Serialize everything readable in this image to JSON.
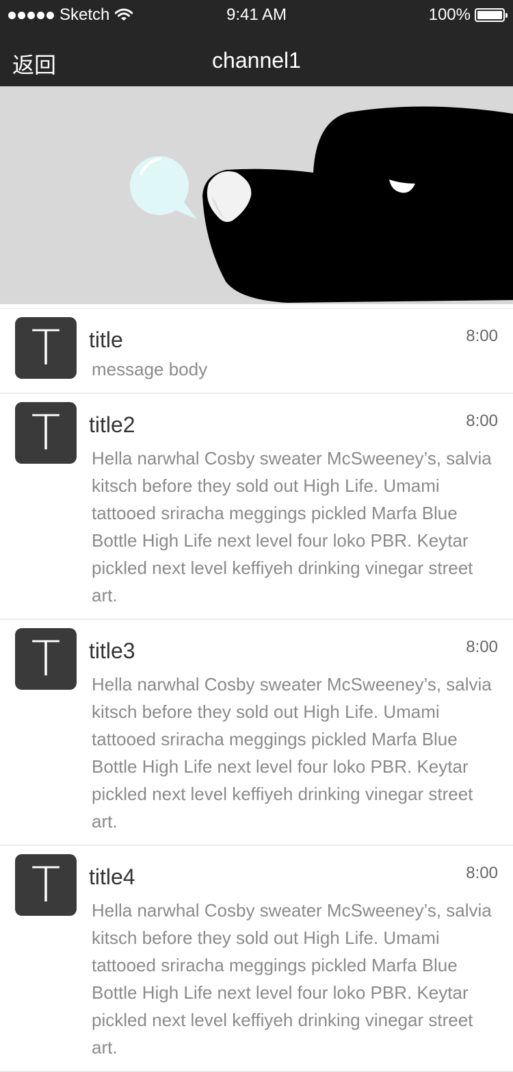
{
  "status_bar": {
    "carrier": "Sketch",
    "time": "9:41 AM",
    "battery": "100%"
  },
  "nav": {
    "back_label": "返回",
    "title": "channel1"
  },
  "messages": [
    {
      "avatar_letter": "T",
      "title": "title",
      "time": "8:00",
      "body": "message body"
    },
    {
      "avatar_letter": "T",
      "title": "title2",
      "time": "8:00",
      "body": "Hella narwhal Cosby sweater McSweeney’s, salvia kitsch before they sold out High Life. Umami tattooed sriracha meggings pickled Marfa Blue Bottle High Life next level four loko PBR. Keytar pickled next level keffiyeh drinking vinegar street art."
    },
    {
      "avatar_letter": "T",
      "title": "title3",
      "time": "8:00",
      "body": "Hella narwhal Cosby sweater McSweeney’s, salvia kitsch before they sold out High Life. Umami tattooed sriracha meggings pickled Marfa Blue Bottle High Life next level four loko PBR. Keytar pickled next level keffiyeh drinking vinegar street art."
    },
    {
      "avatar_letter": "T",
      "title": "title4",
      "time": "8:00",
      "body": "Hella narwhal Cosby sweater McSweeney’s, salvia kitsch before they sold out High Life. Umami tattooed sriracha meggings pickled Marfa Blue Bottle High Life next level four loko PBR. Keytar pickled next level keffiyeh drinking vinegar street art."
    }
  ],
  "colors": {
    "bar_background": "#262626",
    "banner_background": "#d8d8d8",
    "avatar_background": "#3a3a3a",
    "body_text": "#8a8a8a"
  },
  "icons": {
    "signal": "signal-dots-icon",
    "wifi": "wifi-icon",
    "battery": "battery-icon",
    "banner": "dog-bubble-illustration"
  }
}
